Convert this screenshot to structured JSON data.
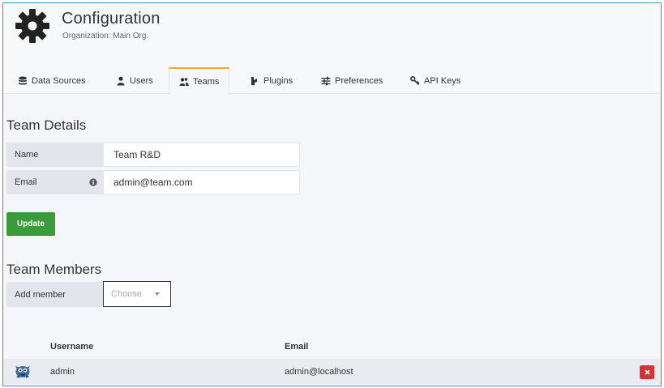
{
  "header": {
    "title": "Configuration",
    "subtitle": "Organization: Main Org."
  },
  "tabs": [
    {
      "label": "Data Sources",
      "icon": "database-icon"
    },
    {
      "label": "Users",
      "icon": "user-icon"
    },
    {
      "label": "Teams",
      "icon": "users-icon",
      "active": true
    },
    {
      "label": "Plugins",
      "icon": "plug-icon"
    },
    {
      "label": "Preferences",
      "icon": "sliders-icon"
    },
    {
      "label": "API Keys",
      "icon": "key-icon"
    }
  ],
  "team_details": {
    "heading": "Team Details",
    "name_label": "Name",
    "name_value": "Team R&D",
    "email_label": "Email",
    "email_value": "admin@team.com",
    "update_label": "Update"
  },
  "team_members": {
    "heading": "Team Members",
    "add_member_label": "Add member",
    "choose_placeholder": "Choose",
    "columns": {
      "username": "Username",
      "email": "Email"
    },
    "rows": [
      {
        "username": "admin",
        "email": "admin@localhost"
      }
    ]
  },
  "colors": {
    "accent": "#f5a623",
    "update_button": "#3b9b3b",
    "delete_button": "#d63232",
    "frame_border": "#2e9bd6"
  }
}
